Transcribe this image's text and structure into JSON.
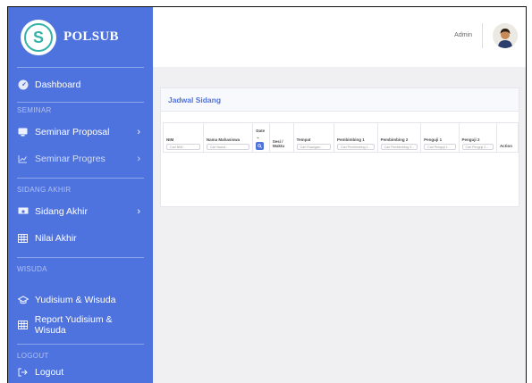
{
  "brand": {
    "name": "POLSUB"
  },
  "sidebar": {
    "dashboard": "Dashboard",
    "sections": [
      "SEMINAR",
      "SIDANG AKHIR",
      "WISUDA",
      "LOGOUT"
    ],
    "items": [
      {
        "label": "Seminar Proposal",
        "icon": "desktop-icon"
      },
      {
        "label": "Seminar Progres",
        "icon": "chart-line-icon"
      },
      {
        "label": "Sidang Akhir",
        "icon": "presentation-icon"
      },
      {
        "label": "Nilai Akhir",
        "icon": "table-icon"
      },
      {
        "label": "Yudisium & Wisuda",
        "icon": "graduation-cap-icon"
      },
      {
        "label": "Report Yudisium & Wisuda",
        "icon": "table-icon"
      },
      {
        "label": "Logout",
        "icon": "sign-out-icon"
      }
    ]
  },
  "topbar": {
    "user": "Admin"
  },
  "card": {
    "title": "Jadwal Sidang",
    "columns": [
      {
        "label": "NIM",
        "placeholder": "Cari NIM..."
      },
      {
        "label": "Nama Mahasiswa",
        "placeholder": "Cari Nama..."
      },
      {
        "label": "Date",
        "placeholder": ""
      },
      {
        "label": "Sesi / Waktu",
        "placeholder": ""
      },
      {
        "label": "Tempat",
        "placeholder": "Cari Ruangan..."
      },
      {
        "label": "Pembimbing 1",
        "placeholder": "Cari Pembimbing 1..."
      },
      {
        "label": "Pembimbing 2",
        "placeholder": "Cari Pembimbing 2..."
      },
      {
        "label": "Penguji 1",
        "placeholder": "Cari Penguji 1..."
      },
      {
        "label": "Penguji 2",
        "placeholder": "Cari Penguji 2..."
      },
      {
        "label": "Action",
        "placeholder": ""
      }
    ]
  },
  "colors": {
    "primary": "#4e73df",
    "logo_accent": "#35b3a8"
  }
}
